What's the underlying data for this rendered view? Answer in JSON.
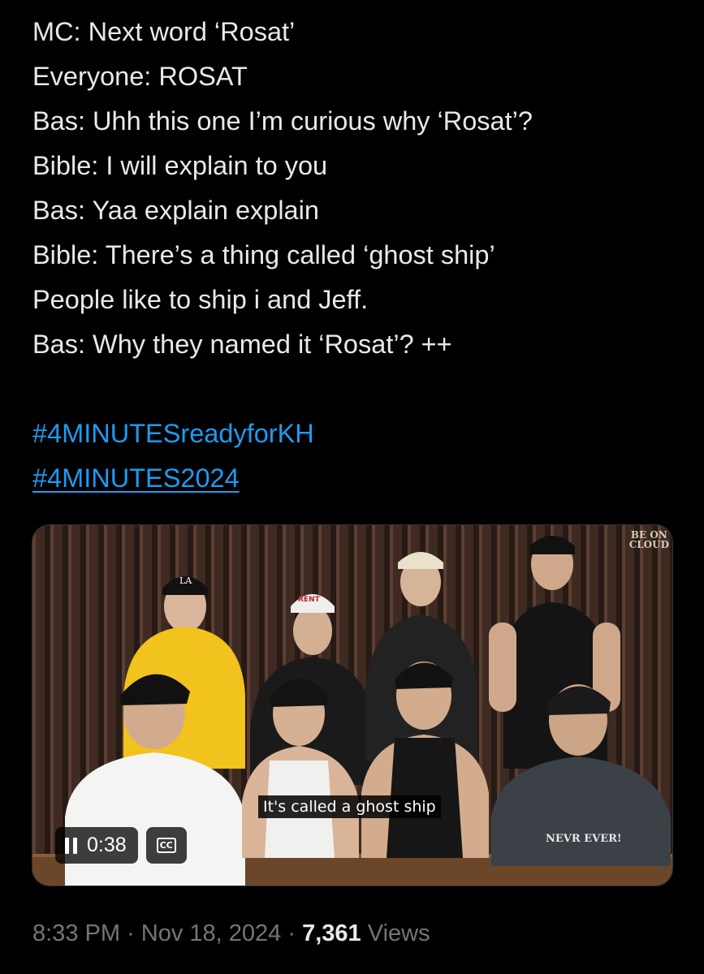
{
  "tweet": {
    "lines": [
      "MC: Next word ‘Rosat’",
      "Everyone: ROSAT",
      "Bas: Uhh this one I’m curious why ‘Rosat’?",
      "Bible: I will explain to you",
      "Bas: Yaa explain explain",
      "Bible: There’s a thing called ‘ghost ship’",
      "People like to ship i and Jeff.",
      "Bas: Why they named it ‘Rosat’? ++"
    ],
    "hashtags": [
      "#4MINUTESreadyforKH",
      "#4MINUTES2024"
    ]
  },
  "video": {
    "subtitle": "It's called a ghost ship",
    "time": "0:38",
    "cc_label": "CC",
    "watermark_line1": "BE ON",
    "watermark_line2": "CLOUD",
    "play_state_icon": "pause-icon",
    "cap_text": "LA",
    "cap2_text": "RENT",
    "shirt_text": "NEVR EVER!"
  },
  "meta": {
    "time": "8:33 PM",
    "separator": "·",
    "date": "Nov 18, 2024",
    "views_count": "7,361",
    "views_label": "Views"
  },
  "colors": {
    "background": "#000000",
    "text": "#e7e9ea",
    "link": "#1d9bf0",
    "secondary": "#71767b"
  }
}
